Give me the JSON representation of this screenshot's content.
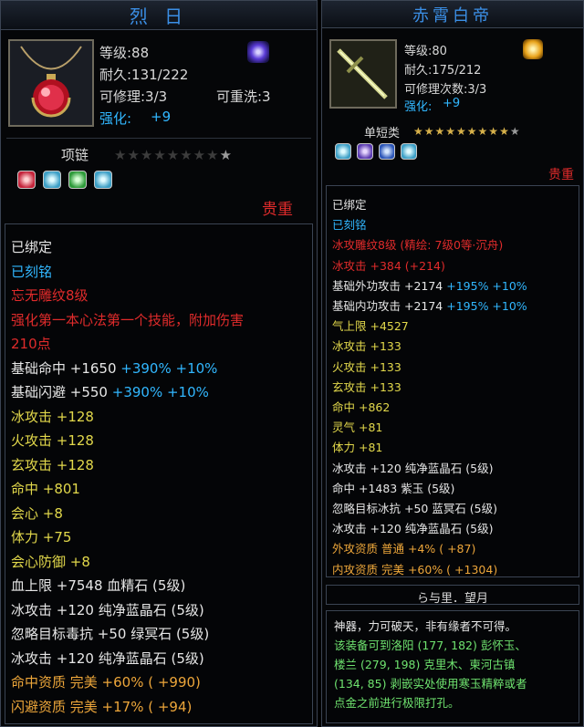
{
  "left": {
    "title": "烈 日",
    "level": "等级:88",
    "durability": "耐久:131/222",
    "repair": "可修理:3/3",
    "rewash": "可重洗:3",
    "enhance_label": "强化:",
    "enhance_value": "+9",
    "category": "项链",
    "star_count": 8,
    "rarity": "贵重",
    "lines": [
      [
        {
          "t": "已绑定",
          "c": "w"
        }
      ],
      [
        {
          "t": "已刻铭",
          "c": "b"
        }
      ],
      [
        {
          "t": "忘无雕纹8级",
          "c": "r"
        }
      ],
      [
        {
          "t": "强化第一本心法第一个技能，附加伤害",
          "c": "r"
        }
      ],
      [
        {
          "t": "210点",
          "c": "r"
        }
      ],
      [
        {
          "t": "基础命中 +1650 ",
          "c": "w"
        },
        {
          "t": "+390% +10%",
          "c": "b"
        }
      ],
      [
        {
          "t": "基础闪避 +550 ",
          "c": "w"
        },
        {
          "t": "+390% +10%",
          "c": "b"
        }
      ],
      [
        {
          "t": "冰攻击 +128",
          "c": "y"
        }
      ],
      [
        {
          "t": "火攻击 +128",
          "c": "y"
        }
      ],
      [
        {
          "t": "玄攻击 +128",
          "c": "y"
        }
      ],
      [
        {
          "t": "命中 +801",
          "c": "y"
        }
      ],
      [
        {
          "t": "会心 +8",
          "c": "y"
        }
      ],
      [
        {
          "t": "体力 +75",
          "c": "y"
        }
      ],
      [
        {
          "t": "会心防御 +8",
          "c": "y"
        }
      ],
      [
        {
          "t": "血上限 +7548 血精石 (5级)",
          "c": "w"
        }
      ],
      [
        {
          "t": "冰攻击 +120 纯净蓝晶石 (5级)",
          "c": "w"
        }
      ],
      [
        {
          "t": "忽略目标毒抗 +50 绿冥石 (5级)",
          "c": "w"
        }
      ],
      [
        {
          "t": "冰攻击 +120 纯净蓝晶石 (5级)",
          "c": "w"
        }
      ],
      [
        {
          "t": "命中资质   完美 +60% ( +990)",
          "c": "o"
        }
      ],
      [
        {
          "t": "闪避资质   完美 +17% ( +94)",
          "c": "o"
        }
      ]
    ]
  },
  "right": {
    "title": "赤霄白帝",
    "level": "等级:80",
    "durability": "耐久:175/212",
    "repair": "可修理次数:3/3",
    "enhance_label": "强化:",
    "enhance_value": "+9",
    "category": "单短类",
    "star_count": 9,
    "rarity": "贵重",
    "lines": [
      [
        {
          "t": "已绑定",
          "c": "w"
        }
      ],
      [
        {
          "t": "已刻铭",
          "c": "b"
        }
      ],
      [
        {
          "t": "冰攻雕纹8级 (精绘: 7级0等·沉舟)",
          "c": "r"
        }
      ],
      [
        {
          "t": "冰攻击 +384 (+214)",
          "c": "r"
        }
      ],
      [
        {
          "t": "基础外功攻击 +2174 ",
          "c": "w"
        },
        {
          "t": "+195% +10%",
          "c": "b"
        }
      ],
      [
        {
          "t": "基础内功攻击 +2174 ",
          "c": "w"
        },
        {
          "t": "+195% +10%",
          "c": "b"
        }
      ],
      [
        {
          "t": "气上限 +4527",
          "c": "y"
        }
      ],
      [
        {
          "t": "冰攻击 +133",
          "c": "y"
        }
      ],
      [
        {
          "t": "火攻击 +133",
          "c": "y"
        }
      ],
      [
        {
          "t": "玄攻击 +133",
          "c": "y"
        }
      ],
      [
        {
          "t": "命中 +862",
          "c": "y"
        }
      ],
      [
        {
          "t": "灵气 +81",
          "c": "y"
        }
      ],
      [
        {
          "t": "体力 +81",
          "c": "y"
        }
      ],
      [
        {
          "t": "冰攻击 +120 纯净蓝晶石 (5级)",
          "c": "w"
        }
      ],
      [
        {
          "t": "命中 +1483 紫玉 (5级)",
          "c": "w"
        }
      ],
      [
        {
          "t": "忽略目标冰抗 +50 蓝冥石 (5级)",
          "c": "w"
        }
      ],
      [
        {
          "t": "冰攻击 +120 纯净蓝晶石 (5级)",
          "c": "w"
        }
      ],
      [
        {
          "t": "外攻资质   普通 +4% ( +87)",
          "c": "o"
        }
      ],
      [
        {
          "t": "内攻资质   完美 +60% ( +1304)",
          "c": "o"
        }
      ]
    ],
    "engraving": "ら与里．望月",
    "desc": [
      {
        "t": "神器，力可破天，非有缘者不可得。",
        "c": "w"
      },
      {
        "t": "该装备可到洛阳 (177, 182) 彭怀玉、",
        "c": "g"
      },
      {
        "t": "楼兰 (279, 198) 克里木、柬河古镇",
        "c": "g"
      },
      {
        "t": "(134, 85) 剥嵌实处使用寒玉精粹或者",
        "c": "g"
      },
      {
        "t": "点金之前进行极限打孔。",
        "c": "g"
      }
    ]
  },
  "colors": {
    "title_blue": "#3b8fe6",
    "white": "#e6e6e6",
    "blue": "#31b7ff",
    "red": "#e02b2b",
    "yellow": "#e2d84b",
    "orange": "#eda63a",
    "green": "#6fe36f"
  }
}
